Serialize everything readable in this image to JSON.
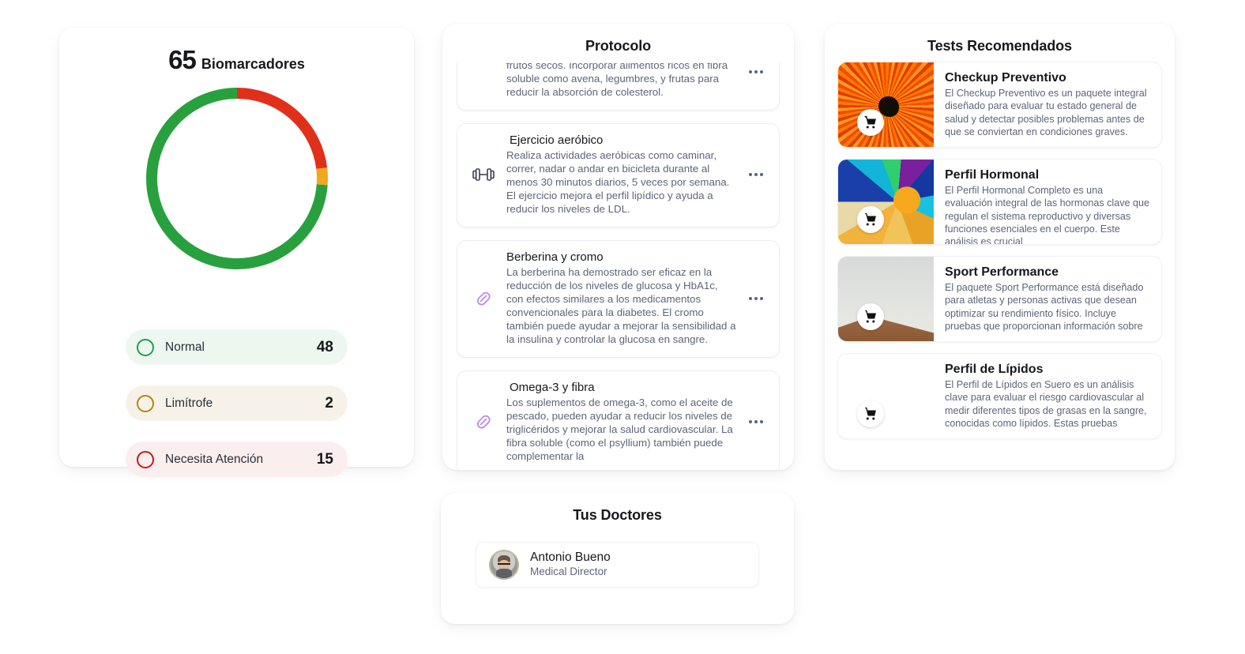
{
  "biomarkers": {
    "count": "65",
    "label": "Biomarcadores",
    "donut": {
      "total": 65,
      "segments": [
        {
          "name": "Necesita Atención",
          "value": 15,
          "color": "#e0301a"
        },
        {
          "name": "Limítrofe",
          "value": 2,
          "color": "#f0a91c"
        },
        {
          "name": "Normal",
          "value": 48,
          "color": "#29a03e"
        }
      ]
    },
    "legend": [
      {
        "label": "Normal",
        "value": "48",
        "ring_color": "#16a34a",
        "bg": "#edf7f0"
      },
      {
        "label": "Limítrofe",
        "value": "2",
        "ring_color": "#b8860b",
        "bg": "#f7f2e9"
      },
      {
        "label": "Necesita Atención",
        "value": "15",
        "ring_color": "#c41b1b",
        "bg": "#fbeeee"
      }
    ]
  },
  "protocol": {
    "title": "Protocolo",
    "items": [
      {
        "name": "",
        "description": "presentes en el aguacate, el aceite de oliva y los frutos secos. Incorporar alimentos ricos en fibra soluble como avena, legumbres, y frutas para reducir la absorción de colesterol.",
        "icon": "none",
        "menu": "more-options"
      },
      {
        "name": "Ejercicio aeróbico",
        "description": "Realiza actividades aeróbicas como caminar, correr, nadar o andar en bicicleta durante al menos 30 minutos diarios, 5 veces por semana. El ejercicio mejora el perfil lipídico y ayuda a reducir los niveles de LDL.",
        "icon": "dumbbell-icon",
        "menu": "more-options"
      },
      {
        "name": "Berberina y cromo",
        "description": "La berberina ha demostrado ser eficaz en la reducción de los niveles de glucosa y HbA1c, con efectos similares a los medicamentos convencionales para la diabetes. El cromo también puede ayudar a mejorar la sensibilidad a la insulina y controlar la glucosa en sangre.",
        "icon": "pill-icon",
        "menu": "more-options"
      },
      {
        "name": "Omega-3 y fibra",
        "description": "Los suplementos de omega-3, como el aceite de pescado, pueden ayudar a reducir los niveles de triglicéridos y mejorar la salud cardiovascular. La fibra soluble (como el psyllium) también puede complementar la",
        "icon": "pill-icon",
        "menu": "more-options"
      }
    ]
  },
  "tests": {
    "title": "Tests Recomendados",
    "items": [
      {
        "name": "Checkup Preventivo",
        "description": "El Checkup Preventivo es un paquete integral diseñado para evaluar tu estado general de salud y detectar posibles problemas antes de que se conviertan en condiciones graves.",
        "thumb": "orange-flower",
        "cart": "cart-icon"
      },
      {
        "name": "Perfil Hormonal",
        "description": "El Perfil Hormonal Completo es una evaluación integral de las hormonas clave que regulan el sistema reproductivo y diversas funciones esenciales en el cuerpo. Este análisis es crucial",
        "thumb": "colorful-wave",
        "cart": "cart-icon"
      },
      {
        "name": "Sport Performance",
        "description": "El paquete Sport Performance está diseñado para atletas y personas activas que desean optimizar su rendimiento físico. Incluye pruebas que proporcionan información sobre",
        "thumb": "sand-dune",
        "cart": "cart-icon"
      },
      {
        "name": "Perfil de Lípidos",
        "description": "El Perfil de Lípidos en Suero es un análisis clave para evaluar el riesgo cardiovascular al medir diferentes tipos de grasas en la sangre, conocidas como lípidos. Estas pruebas",
        "thumb": "blank",
        "cart": "cart-icon"
      }
    ]
  },
  "doctors": {
    "title": "Tus Doctores",
    "items": [
      {
        "name": "Antonio Bueno",
        "role": "Medical Director"
      }
    ]
  }
}
